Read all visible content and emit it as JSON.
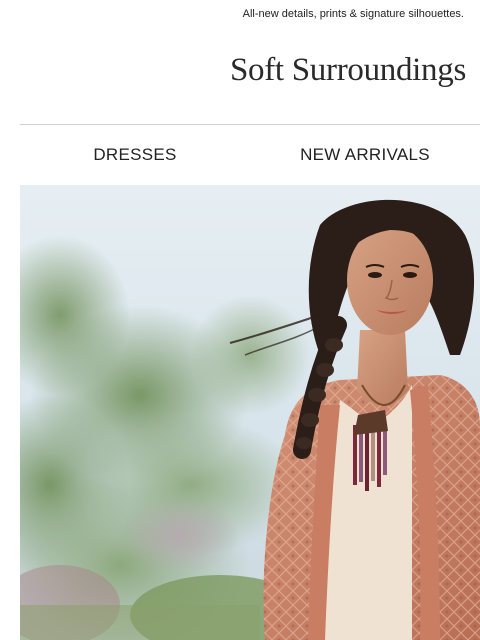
{
  "preheader": {
    "text": "All-new details, prints & signature silhouettes."
  },
  "brand": {
    "logo_text": "Soft Surroundings"
  },
  "nav": {
    "items": [
      {
        "label": "DRESSES"
      },
      {
        "label": "NEW ARRIVALS"
      }
    ]
  },
  "hero": {
    "image": "woman-in-coral-lace-cardigan-photo"
  },
  "colors": {
    "sky": "#dfe9ef",
    "foliage": "#7f9c66",
    "cardigan": "#c98468",
    "hair": "#2b1d17",
    "skin": "#c89072"
  }
}
